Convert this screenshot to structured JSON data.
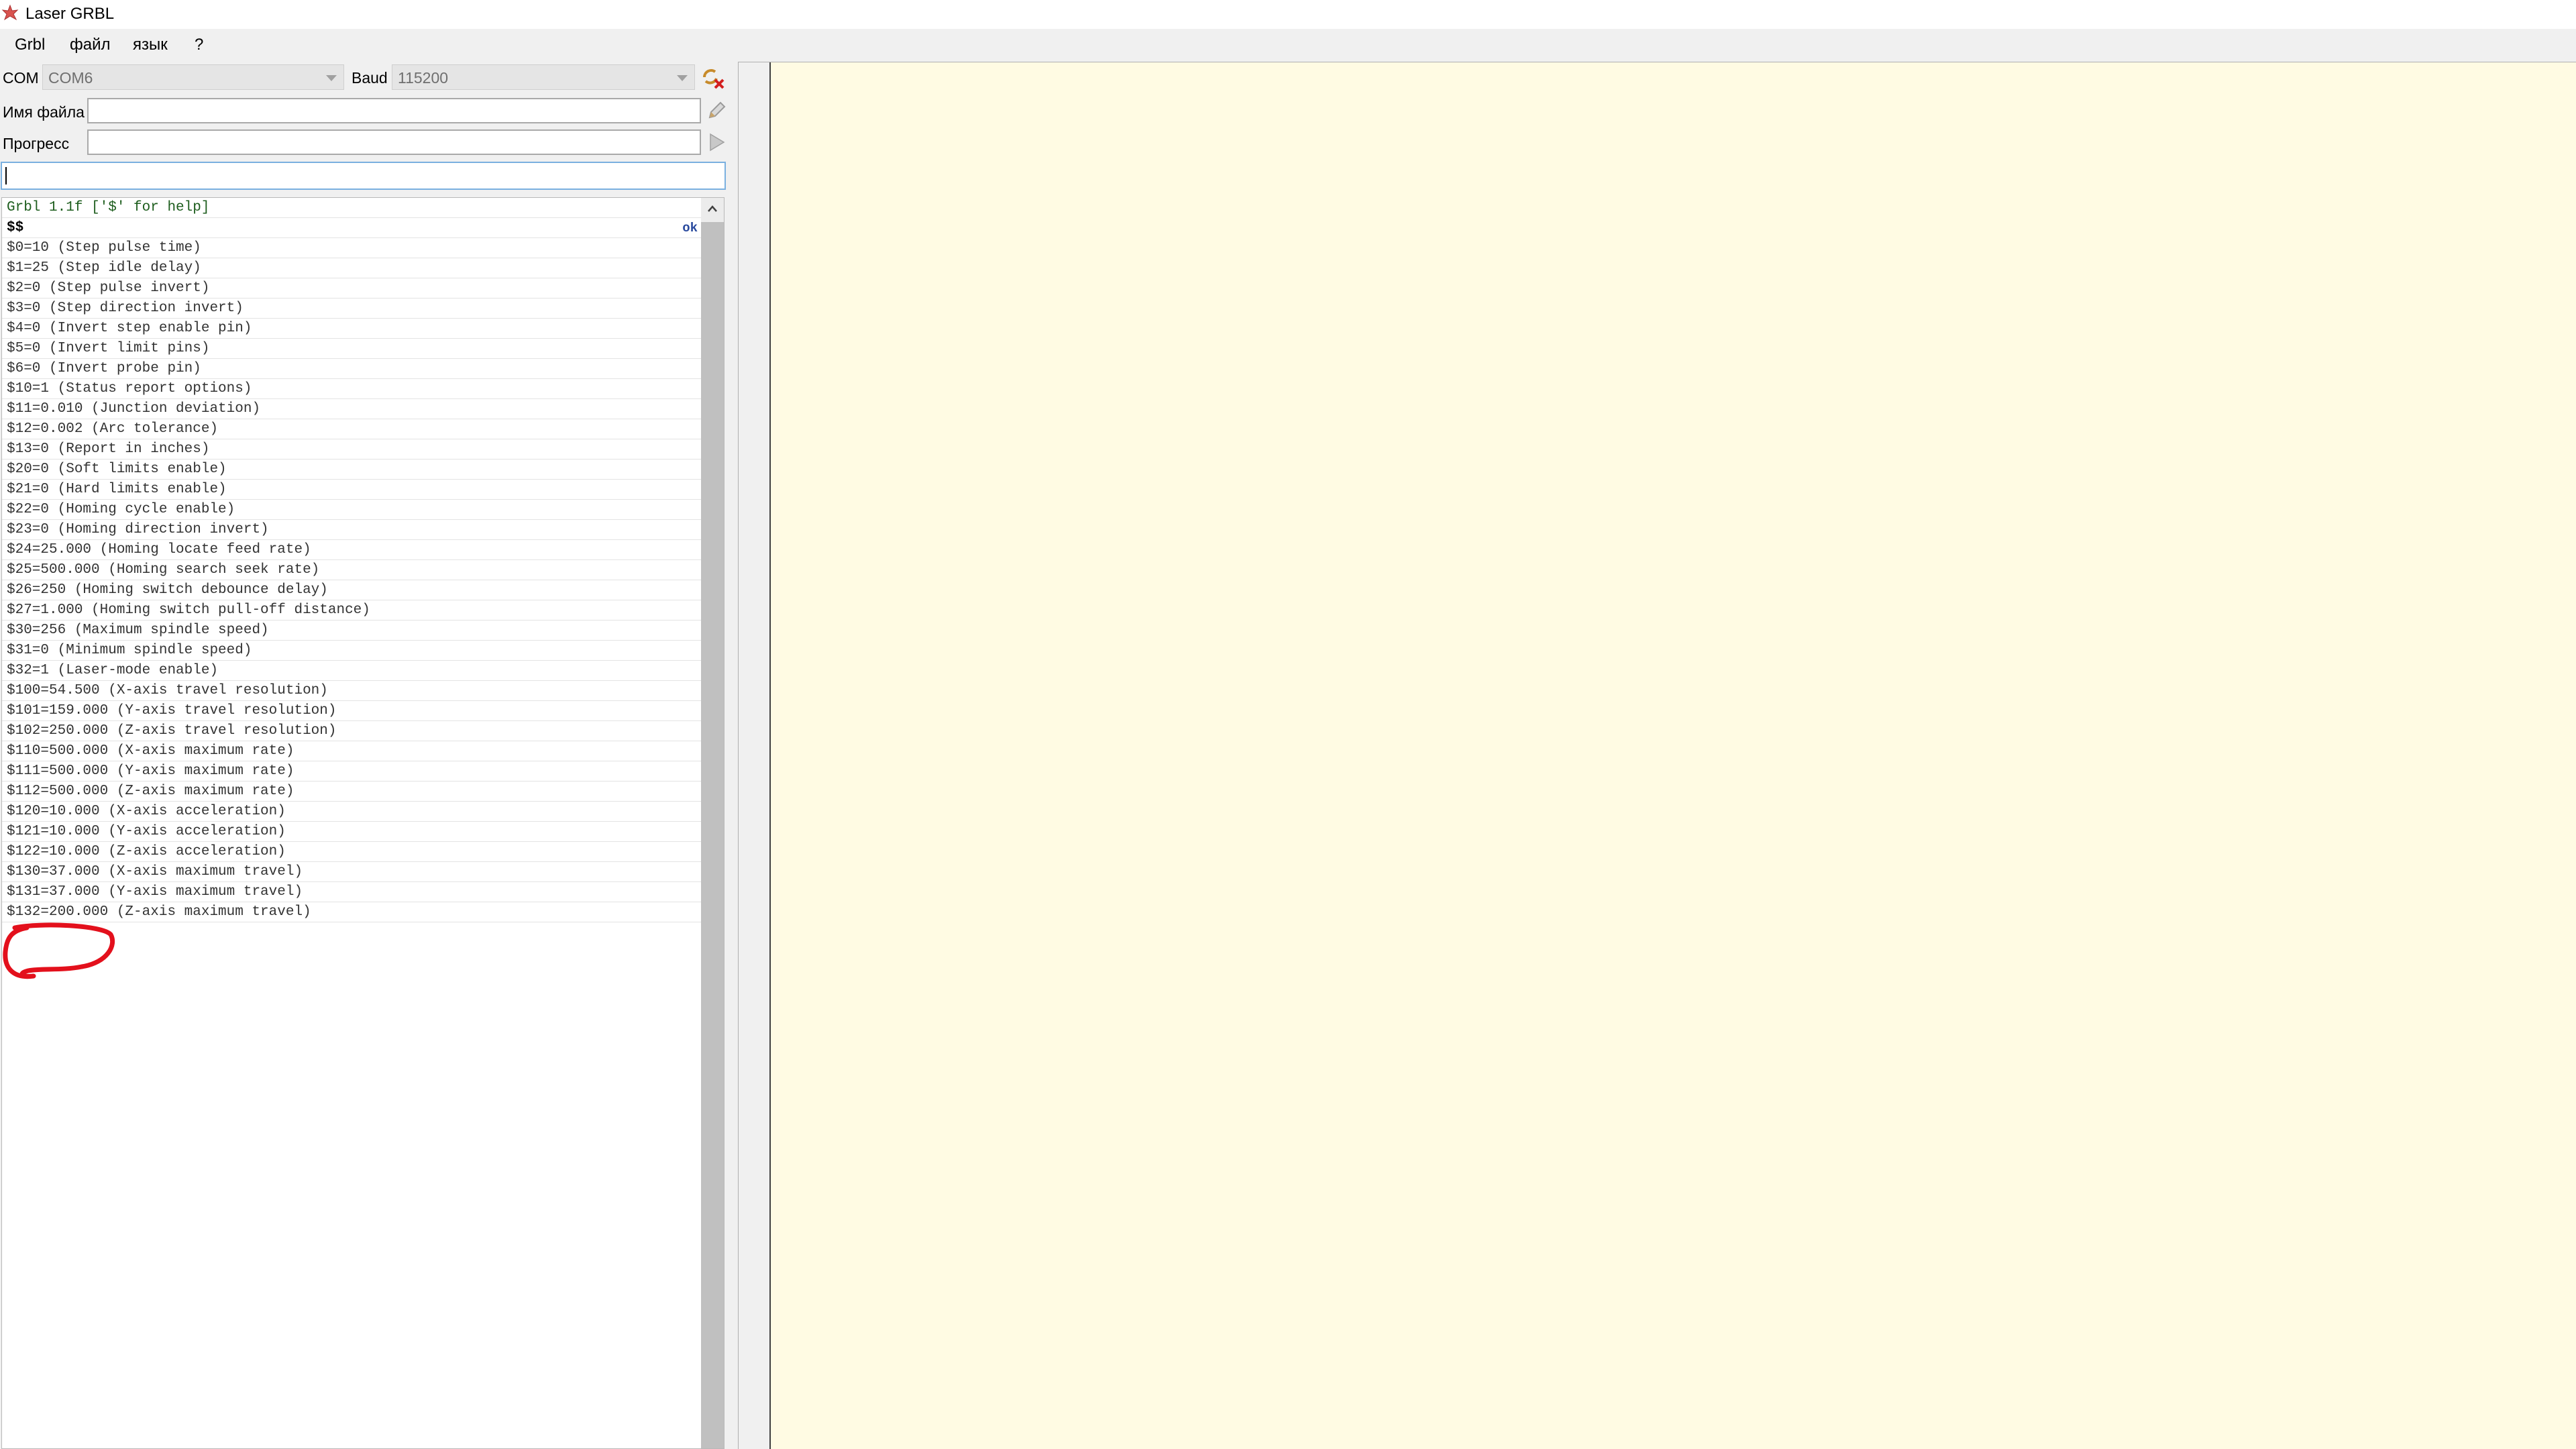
{
  "window": {
    "title": "Laser GRBL"
  },
  "menu": [
    "Grbl",
    "файл",
    "язык",
    "?"
  ],
  "connection": {
    "com_label": "COM",
    "com_value": "COM6",
    "baud_label": "Baud",
    "baud_value": "115200"
  },
  "file": {
    "label": "Имя файла",
    "value": ""
  },
  "progress": {
    "label": "Прогресс",
    "value": 0
  },
  "command": {
    "value": ""
  },
  "console": {
    "header": "Grbl 1.1f ['$' for help]",
    "command": "$$",
    "command_status": "ok",
    "lines": [
      "$0=10 (Step pulse time)",
      "$1=25 (Step idle delay)",
      "$2=0 (Step pulse invert)",
      "$3=0 (Step direction invert)",
      "$4=0 (Invert step enable pin)",
      "$5=0 (Invert limit pins)",
      "$6=0 (Invert probe pin)",
      "$10=1 (Status report options)",
      "$11=0.010 (Junction deviation)",
      "$12=0.002 (Arc tolerance)",
      "$13=0 (Report in inches)",
      "$20=0 (Soft limits enable)",
      "$21=0 (Hard limits enable)",
      "$22=0 (Homing cycle enable)",
      "$23=0 (Homing direction invert)",
      "$24=25.000 (Homing locate feed rate)",
      "$25=500.000 (Homing search seek rate)",
      "$26=250 (Homing switch debounce delay)",
      "$27=1.000 (Homing switch pull-off distance)",
      "$30=256 (Maximum spindle speed)",
      "$31=0 (Minimum spindle speed)",
      "$32=1 (Laser-mode enable)",
      "$100=54.500 (X-axis travel resolution)",
      "$101=159.000 (Y-axis travel resolution)",
      "$102=250.000 (Z-axis travel resolution)",
      "$110=500.000 (X-axis maximum rate)",
      "$111=500.000 (Y-axis maximum rate)",
      "$112=500.000 (Z-axis maximum rate)",
      "$120=10.000 (X-axis acceleration)",
      "$121=10.000 (Y-axis acceleration)",
      "$122=10.000 (Z-axis acceleration)",
      "$130=37.000 (X-axis maximum travel)",
      "$131=37.000 (Y-axis maximum travel)",
      "$132=200.000 (Z-axis maximum travel)"
    ]
  },
  "colors": {
    "highlight": "#e3101c",
    "preview_bg": "#fffbe3",
    "panel_bg": "#f0f0f0"
  },
  "icons": {
    "app": "laser-grbl-logo-icon",
    "connect": "connect-disconnect-icon",
    "open_file": "pencil-icon",
    "run": "play-icon"
  }
}
